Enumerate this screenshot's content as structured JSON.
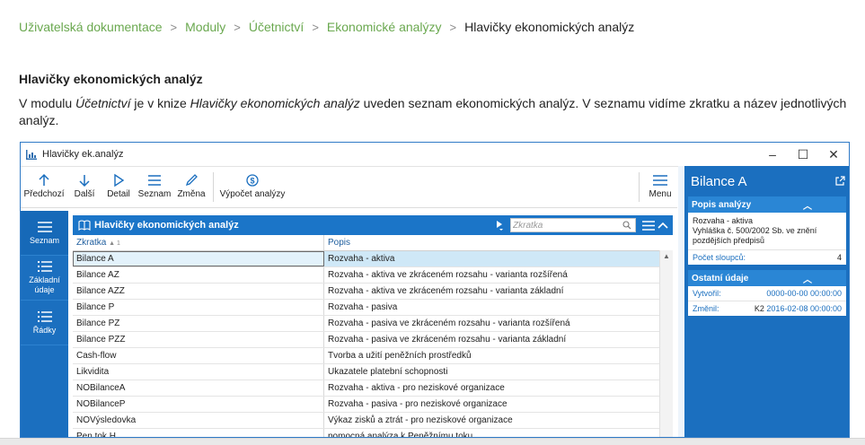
{
  "breadcrumb": {
    "items": [
      "Uživatelská dokumentace",
      "Moduly",
      "Účetnictví",
      "Ekonomické analýzy"
    ],
    "separator": ">",
    "current": "Hlavičky ekonomických analýz"
  },
  "section": {
    "title": "Hlavičky ekonomických analýz",
    "intro_p1": "V modulu ",
    "intro_em1": "Účetnictví",
    "intro_p2": " je v knize ",
    "intro_em2": "Hlavičky ekonomických analýz",
    "intro_p3": " uveden seznam ekonomických analýz. V seznamu vidíme zkratku a název jednotlivých analýz."
  },
  "window": {
    "title": "Hlavičky ek.analýz",
    "minimize": "–",
    "maximize": "☐",
    "close": "✕"
  },
  "toolbar": {
    "prev": "Předchozí",
    "next": "Další",
    "detail": "Detail",
    "list": "Seznam",
    "edit": "Změna",
    "calc": "Výpočet analýzy",
    "menu": "Menu"
  },
  "nav": {
    "list": "Seznam",
    "basic": "Základní údaje",
    "rows": "Řádky"
  },
  "grid": {
    "title": "Hlavičky ekonomických analýz",
    "search_placeholder": "Zkratka",
    "col_code": "Zkratka",
    "col_code_sort": "▲ 1",
    "col_desc": "Popis",
    "rows": [
      {
        "code": "Bilance A",
        "desc": "Rozvaha - aktiva"
      },
      {
        "code": "Bilance AZ",
        "desc": "Rozvaha - aktiva ve zkráceném rozsahu - varianta rozšířená"
      },
      {
        "code": "Bilance AZZ",
        "desc": "Rozvaha - aktiva ve zkráceném rozsahu - varianta základní"
      },
      {
        "code": "Bilance P",
        "desc": "Rozvaha - pasiva"
      },
      {
        "code": "Bilance PZ",
        "desc": "Rozvaha - pasiva ve zkráceném rozsahu - varianta rozšířená"
      },
      {
        "code": "Bilance PZZ",
        "desc": "Rozvaha - pasiva ve zkráceném rozsahu - varianta základní"
      },
      {
        "code": "Cash-flow",
        "desc": "Tvorba a užití peněžních prostředků"
      },
      {
        "code": "Likvidita",
        "desc": "Ukazatele platební schopnosti"
      },
      {
        "code": "NOBilanceA",
        "desc": "Rozvaha - aktiva - pro neziskové organizace"
      },
      {
        "code": "NOBilanceP",
        "desc": "Rozvaha - pasiva - pro neziskové organizace"
      },
      {
        "code": "NOVýsledovka",
        "desc": "Výkaz zisků a ztrát - pro neziskové organizace"
      },
      {
        "code": "Pen.tok H",
        "desc": "pomocná analýza k Peněžnímu toku"
      }
    ]
  },
  "right_panel": {
    "title": "Bilance A",
    "desc_section": "Popis analýzy",
    "desc_line1": "Rozvaha - aktiva",
    "desc_line2": "Vyhláška č. 500/2002 Sb. ve znění pozdějších předpisů",
    "columns_label": "Počet sloupců:",
    "columns_value": "4",
    "other_section": "Ostatní údaje",
    "created_label": "Vytvořil:",
    "created_value": "0000-00-00 00:00:00",
    "changed_label": "Změnil:",
    "changed_user": "K2",
    "changed_value": "2016-02-08 00:00:00"
  },
  "colors": {
    "link_green": "#6aa84f",
    "accent_blue": "#1b6fbf",
    "grid_header_blue": "#1b75c8",
    "selection": "#cfe8f7"
  }
}
